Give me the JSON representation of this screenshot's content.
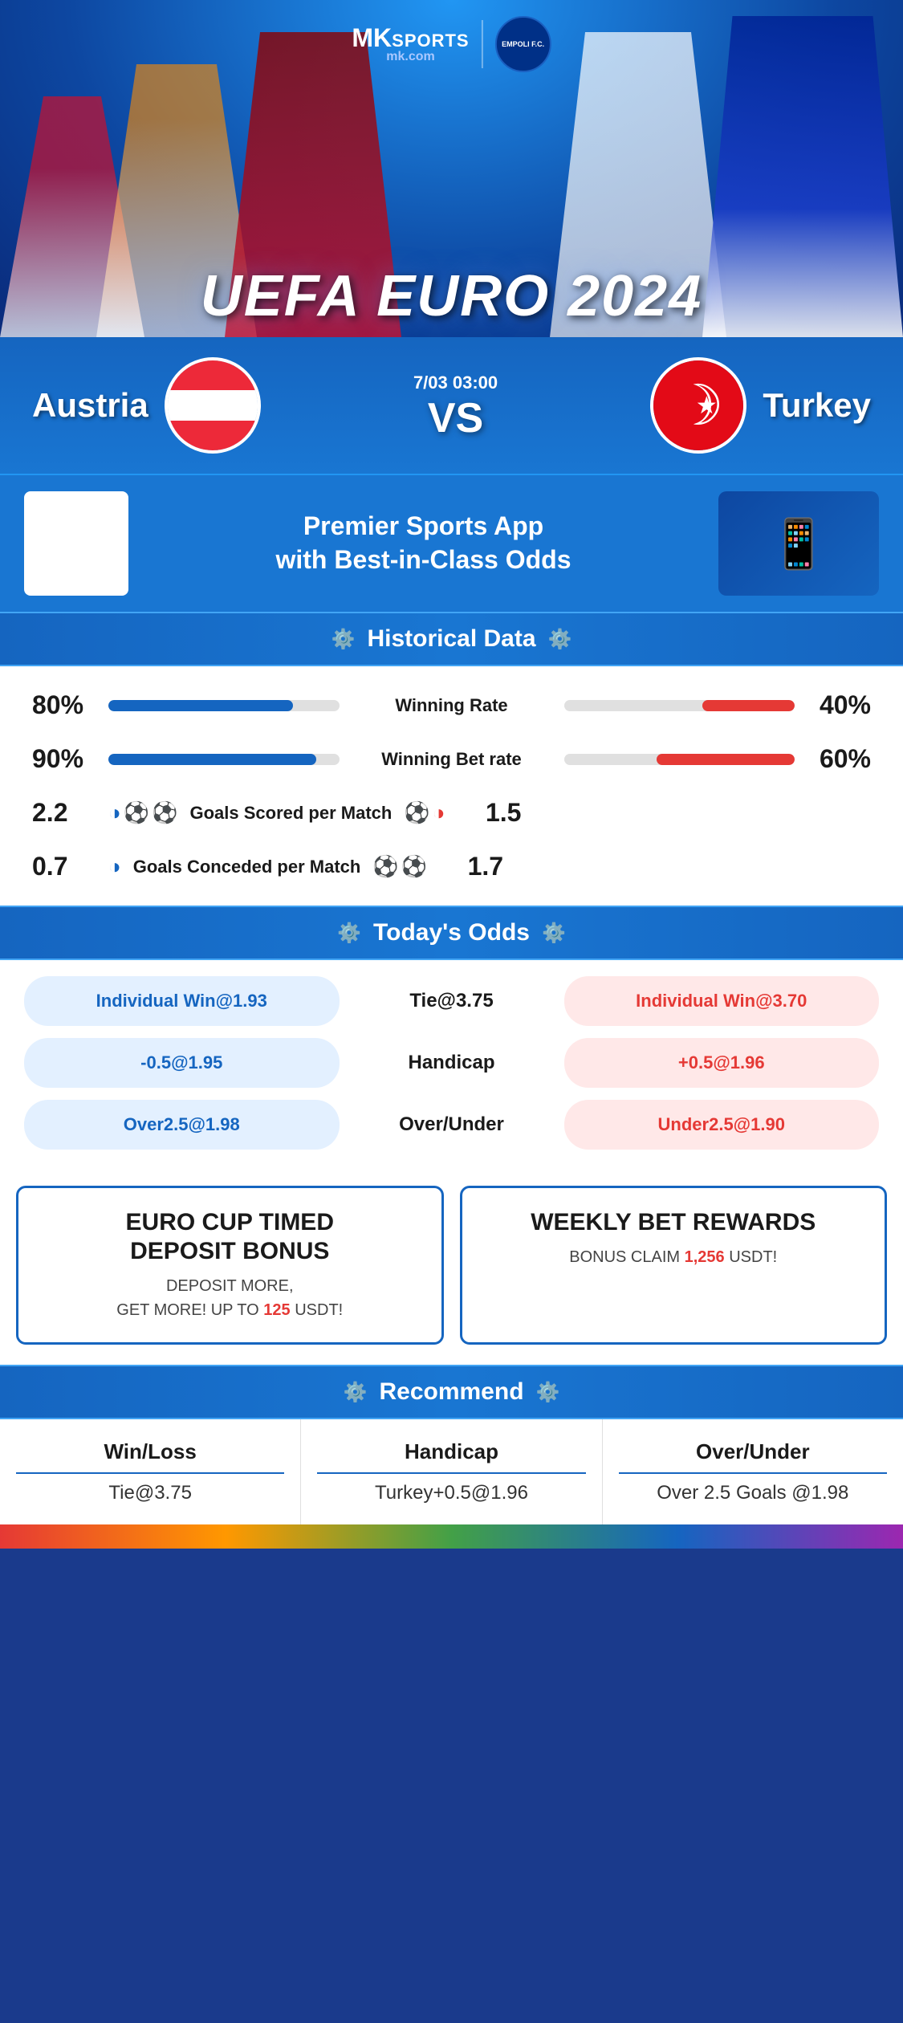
{
  "header": {
    "logo": {
      "brand": "MK",
      "sports": "SPORTS",
      "site": "mk.com"
    },
    "partner": "EMPOLI F.C.",
    "euro_title": "UEFA EURO 2024"
  },
  "match": {
    "home_team": "Austria",
    "away_team": "Turkey",
    "date": "7/03 03:00",
    "vs": "VS"
  },
  "promo": {
    "title": "Premier Sports App\nwith Best-in-Class Odds"
  },
  "historical": {
    "section_title": "Historical Data",
    "stats": [
      {
        "label": "Winning Rate",
        "home_value": "80%",
        "away_value": "40%",
        "home_pct": 80,
        "away_pct": 40
      },
      {
        "label": "Winning Bet rate",
        "home_value": "90%",
        "away_value": "60%",
        "home_pct": 90,
        "away_pct": 60
      },
      {
        "label": "Goals Scored per Match",
        "home_value": "2.2",
        "away_value": "1.5",
        "home_pct": null,
        "away_pct": null
      },
      {
        "label": "Goals Conceded per Match",
        "home_value": "0.7",
        "away_value": "1.7",
        "home_pct": null,
        "away_pct": null
      }
    ]
  },
  "odds": {
    "section_title": "Today's Odds",
    "rows": [
      {
        "home": "Individual Win@1.93",
        "center": "Tie@3.75",
        "away": "Individual Win@3.70",
        "center_label": ""
      },
      {
        "home": "-0.5@1.95",
        "center": "Handicap",
        "away": "+0.5@1.96",
        "center_label": "Handicap"
      },
      {
        "home": "Over2.5@1.98",
        "center": "Over/Under",
        "away": "Under2.5@1.90",
        "center_label": "Over/Under"
      }
    ]
  },
  "bonus": {
    "card1": {
      "title": "EURO CUP TIMED DEPOSIT BONUS",
      "desc": "DEPOSIT MORE, GET MORE! UP TO",
      "highlight": "125",
      "suffix": "USDT!"
    },
    "card2": {
      "title": "WEEKLY BET REWARDS",
      "desc": "BONUS CLAIM",
      "highlight": "1,256",
      "suffix": "USDT!"
    }
  },
  "recommend": {
    "section_title": "Recommend",
    "cols": [
      {
        "title": "Win/Loss",
        "value": "Tie@3.75"
      },
      {
        "title": "Handicap",
        "value": "Turkey+0.5@1.96"
      },
      {
        "title": "Over/Under",
        "value": "Over 2.5 Goals @1.98"
      }
    ]
  }
}
